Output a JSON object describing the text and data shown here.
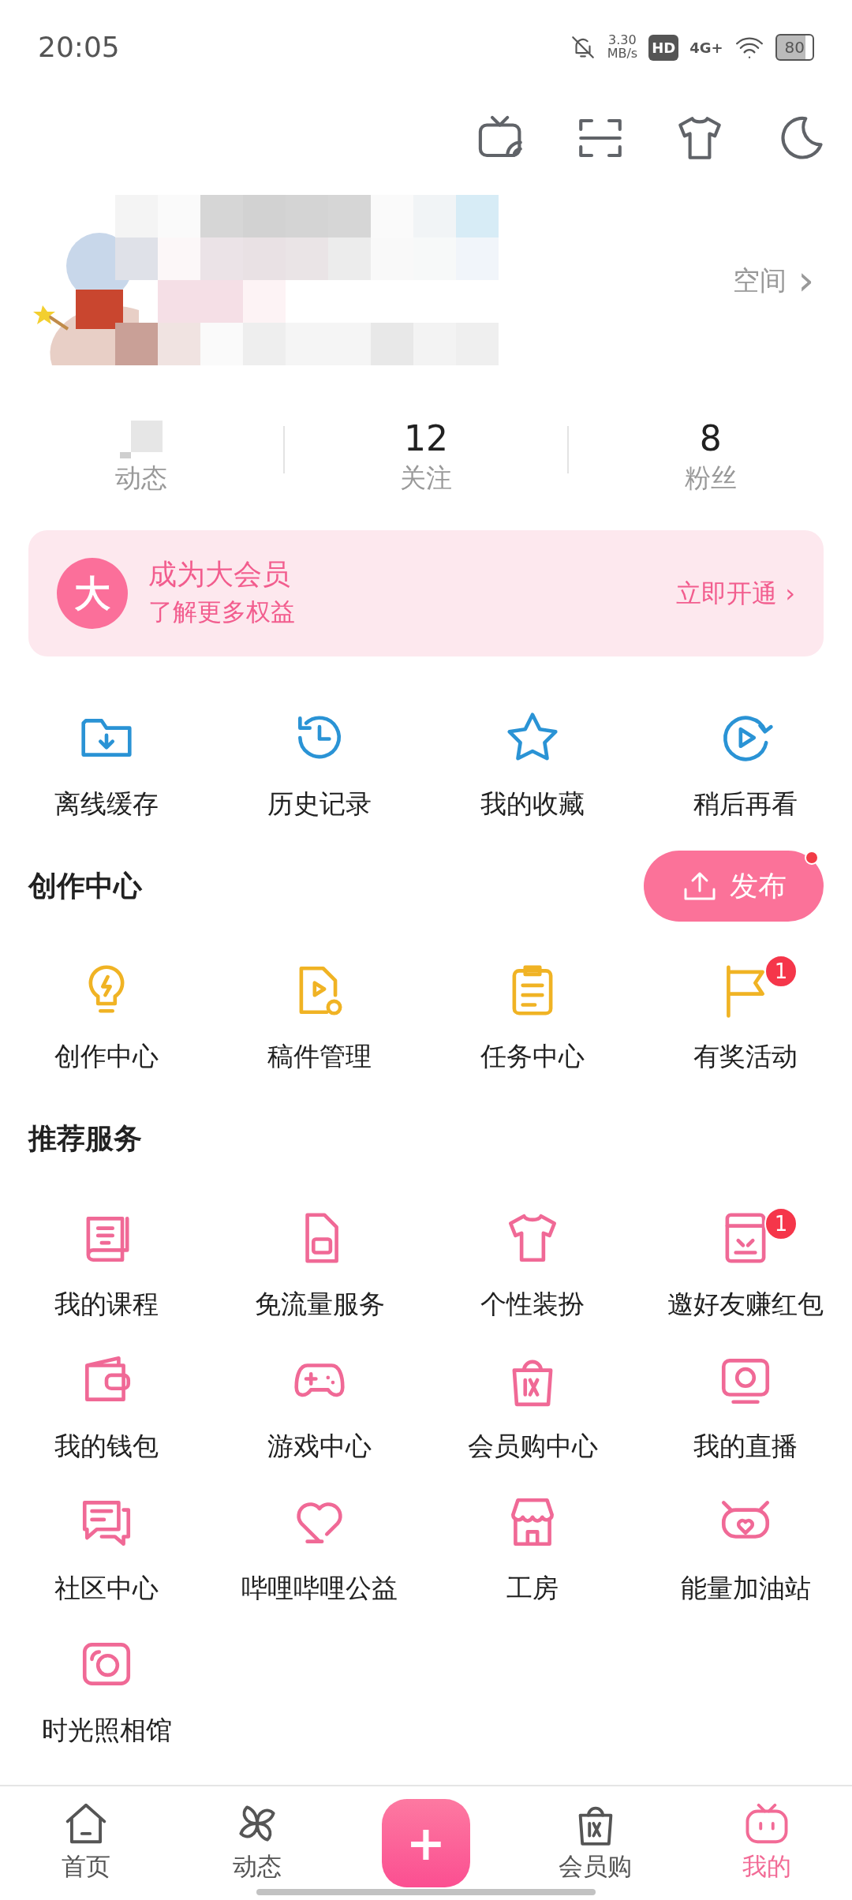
{
  "status_bar": {
    "time": "20:05",
    "speed": "3.30",
    "speed_unit": "MB/s",
    "hd": "HD",
    "network": "4G+",
    "battery": "80"
  },
  "profile": {
    "space_link": "空间",
    "space_chevron": "›"
  },
  "stats": [
    {
      "label": "动态"
    },
    {
      "value": "12",
      "label": "关注"
    },
    {
      "value": "8",
      "label": "粉丝"
    }
  ],
  "vip_banner": {
    "badge": "大",
    "title": "成为大会员",
    "subtitle": "了解更多权益",
    "action": "立即开通",
    "action_chevron": "›"
  },
  "quick_links": [
    {
      "label": "离线缓存"
    },
    {
      "label": "历史记录"
    },
    {
      "label": "我的收藏"
    },
    {
      "label": "稍后再看"
    }
  ],
  "creator": {
    "title": "创作中心",
    "publish_button": "发布",
    "publish_dot": true,
    "items": [
      {
        "label": "创作中心"
      },
      {
        "label": "稿件管理"
      },
      {
        "label": "任务中心"
      },
      {
        "label": "有奖活动",
        "badge": "1"
      }
    ]
  },
  "services": {
    "title": "推荐服务",
    "items": [
      {
        "label": "我的课程"
      },
      {
        "label": "免流量服务"
      },
      {
        "label": "个性装扮"
      },
      {
        "label": "邀好友赚红包",
        "badge": "1"
      },
      {
        "label": "我的钱包"
      },
      {
        "label": "游戏中心"
      },
      {
        "label": "会员购中心"
      },
      {
        "label": "我的直播"
      },
      {
        "label": "社区中心"
      },
      {
        "label": "哔哩哔哩公益"
      },
      {
        "label": "工房"
      },
      {
        "label": "能量加油站"
      },
      {
        "label": "时光照相馆"
      }
    ]
  },
  "bottom_nav": [
    {
      "kind": "tab",
      "label": "首页",
      "selected": false
    },
    {
      "kind": "tab",
      "label": "动态",
      "selected": false
    },
    {
      "kind": "add",
      "label": "+"
    },
    {
      "kind": "tab",
      "label": "会员购",
      "selected": false
    },
    {
      "kind": "tab",
      "label": "我的",
      "selected": true
    }
  ]
}
